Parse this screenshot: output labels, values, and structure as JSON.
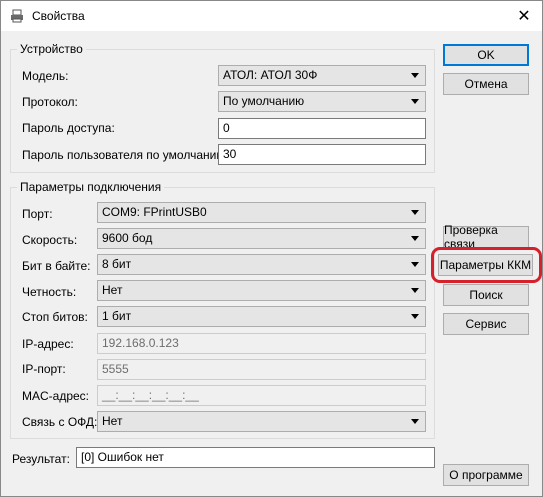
{
  "window": {
    "title": "Свойства",
    "close_symbol": "✕"
  },
  "device_group": {
    "title": "Устройство",
    "model_label": "Модель:",
    "model_value": "АТОЛ: АТОЛ 30Ф",
    "protocol_label": "Протокол:",
    "protocol_value": "По умолчанию",
    "access_password_label": "Пароль доступа:",
    "access_password_value": "0",
    "user_password_label": "Пароль пользователя по умолчанию:",
    "user_password_value": "30"
  },
  "connection_group": {
    "title": "Параметры подключения",
    "port_label": "Порт:",
    "port_value": "COM9: FPrintUSB0",
    "speed_label": "Скорость:",
    "speed_value": "9600 бод",
    "bits_label": "Бит в байте:",
    "bits_value": "8 бит",
    "parity_label": "Четность:",
    "parity_value": "Нет",
    "stop_bits_label": "Стоп битов:",
    "stop_bits_value": "1 бит",
    "ip_label": "IP-адрес:",
    "ip_value": "192.168.0.123",
    "ip_port_label": "IP-порт:",
    "ip_port_value": "5555",
    "mac_label": "MAC-адрес:",
    "mac_value": "__:__:__:__:__:__",
    "ofd_label": "Связь с ОФД:",
    "ofd_value": "Нет"
  },
  "result": {
    "label": "Результат:",
    "value": "[0] Ошибок нет"
  },
  "buttons": {
    "ok": "OK",
    "cancel": "Отмена",
    "check_connection": "Проверка связи",
    "kkm_params": "Параметры ККМ",
    "search": "Поиск",
    "service": "Сервис",
    "about": "О программе"
  },
  "highlight_color": "#d6202b"
}
